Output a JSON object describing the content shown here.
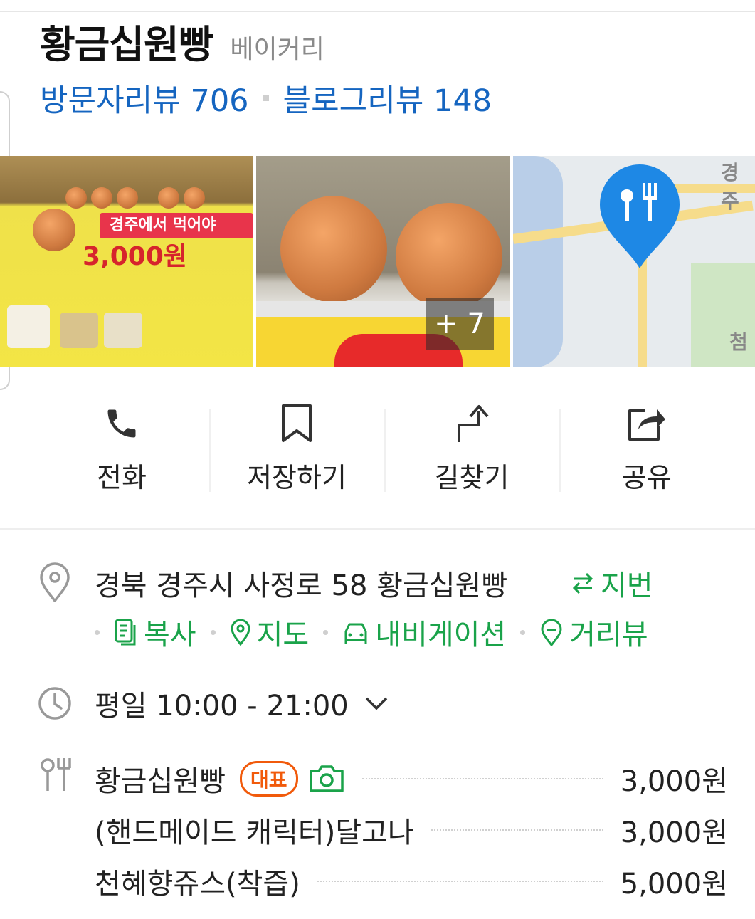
{
  "place": {
    "name": "황금십원빵",
    "category": "베이커리"
  },
  "reviews": {
    "visitor_label": "방문자리뷰 706",
    "blog_label": "블로그리뷰 148"
  },
  "photos": {
    "banner_text": "경주에서 먹어야",
    "banner_price": "3,000원",
    "more_count": "+ 7",
    "map_label_top": "경주",
    "map_label_side": "첨"
  },
  "actions": [
    {
      "label": "전화",
      "icon": "phone-icon"
    },
    {
      "label": "저장하기",
      "icon": "bookmark-icon"
    },
    {
      "label": "길찾기",
      "icon": "directions-icon"
    },
    {
      "label": "공유",
      "icon": "share-icon"
    }
  ],
  "address": {
    "text": "경북 경주시 사정로 58 황금십원빵",
    "jibun_label": "지번",
    "copy_label": "복사",
    "map_label": "지도",
    "navigation_label": "내비게이션",
    "street_view_label": "거리뷰"
  },
  "hours": {
    "text": "평일 10:00 - 21:00"
  },
  "menu": {
    "representative_badge": "대표",
    "items": [
      {
        "name": "황금십원빵",
        "price": "3,000원"
      },
      {
        "name": "(핸드메이드 캐릭터)달고나",
        "price": "3,000원"
      },
      {
        "name": "천혜향쥬스(착즙)",
        "price": "5,000원"
      }
    ]
  },
  "colors": {
    "link_blue": "#1565c0",
    "accent_green": "#1aa34a",
    "badge_orange": "#f15a0b",
    "map_pin_blue": "#1e88e5"
  }
}
